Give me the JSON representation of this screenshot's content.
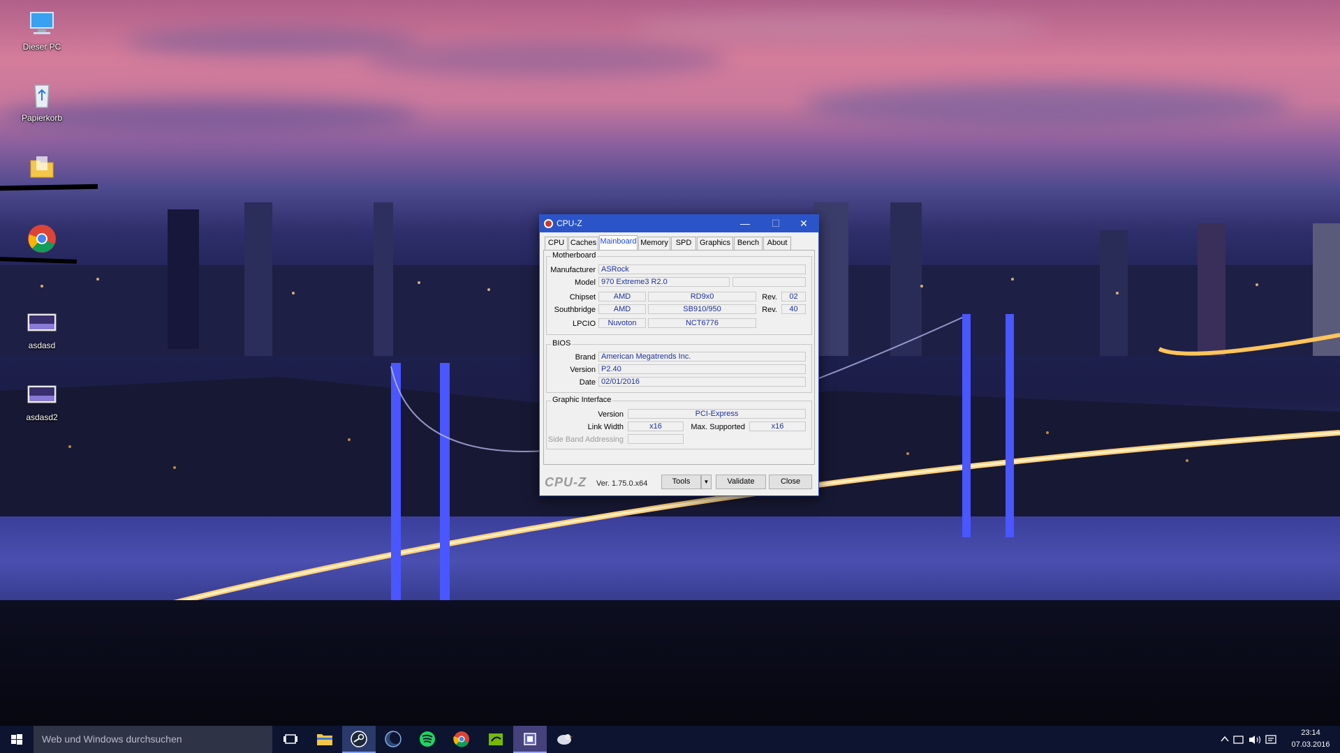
{
  "desktop": {
    "icons": [
      {
        "label": "Dieser PC"
      },
      {
        "label": "Papierkorb"
      },
      {
        "label": ""
      },
      {
        "label": ""
      },
      {
        "label": "asdasd"
      },
      {
        "label": "asdasd2"
      }
    ]
  },
  "cpuz": {
    "title": "CPU-Z",
    "controls": {
      "minimize": "—",
      "maximize": "☐",
      "close": "✕"
    },
    "tabs": [
      "CPU",
      "Caches",
      "Mainboard",
      "Memory",
      "SPD",
      "Graphics",
      "Bench",
      "About"
    ],
    "active_tab": "Mainboard",
    "motherboard": {
      "group_title": "Motherboard",
      "manufacturer_label": "Manufacturer",
      "manufacturer": "ASRock",
      "model_label": "Model",
      "model": "970 Extreme3 R2.0",
      "model_extra": "",
      "chipset_label": "Chipset",
      "chipset_vendor": "AMD",
      "chipset_name": "RD9x0",
      "chipset_rev_label": "Rev.",
      "chipset_rev": "02",
      "southbridge_label": "Southbridge",
      "southbridge_vendor": "AMD",
      "southbridge_name": "SB910/950",
      "southbridge_rev_label": "Rev.",
      "southbridge_rev": "40",
      "lpcio_label": "LPCIO",
      "lpcio_vendor": "Nuvoton",
      "lpcio_name": "NCT6776"
    },
    "bios": {
      "group_title": "BIOS",
      "brand_label": "Brand",
      "brand": "American Megatrends Inc.",
      "version_label": "Version",
      "version": "P2.40",
      "date_label": "Date",
      "date": "02/01/2016"
    },
    "graphic_interface": {
      "group_title": "Graphic Interface",
      "version_label": "Version",
      "version": "PCI-Express",
      "link_width_label": "Link Width",
      "link_width": "x16",
      "max_supported_label": "Max. Supported",
      "max_supported": "x16",
      "side_band_label": "Side Band Addressing",
      "side_band": ""
    },
    "footer": {
      "logo": "CPU-Z",
      "version": "Ver. 1.75.0.x64",
      "tools_label": "Tools",
      "tools_arrow": "▼",
      "validate_label": "Validate",
      "close_label": "Close"
    }
  },
  "taskbar": {
    "search_placeholder": "Web und Windows durchsuchen",
    "apps": [
      "task-view",
      "file-explorer",
      "steam",
      "app-blue",
      "spotify",
      "chrome",
      "nvidia",
      "cpuz",
      "app-bird"
    ],
    "tray": {
      "time": "23:14",
      "date": "07.03.2016"
    }
  }
}
